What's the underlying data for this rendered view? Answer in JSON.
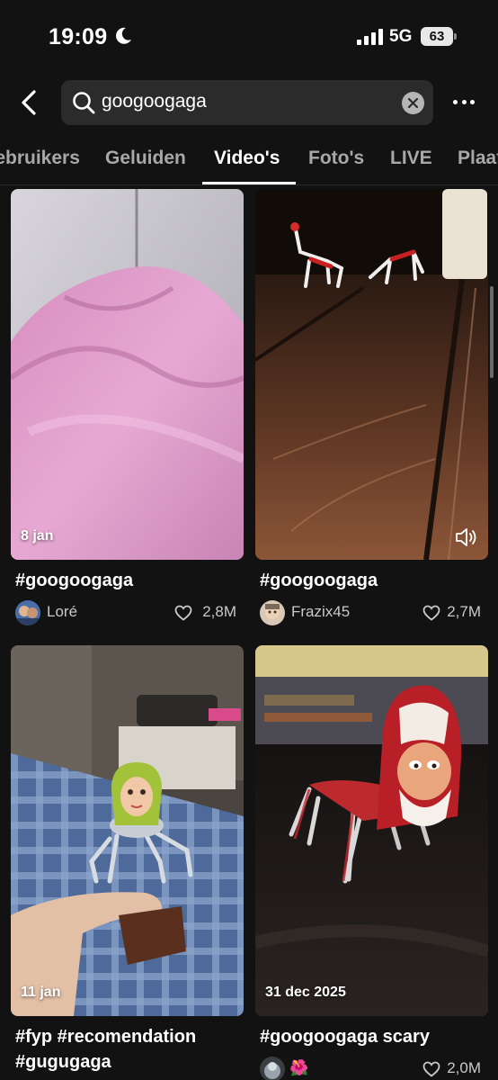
{
  "status_bar": {
    "time": "19:09",
    "network": "5G",
    "battery": "63"
  },
  "search": {
    "query": "googoogaga"
  },
  "tabs": [
    {
      "label": "Gebruikers"
    },
    {
      "label": "Geluiden"
    },
    {
      "label": "Video's"
    },
    {
      "label": "Foto's"
    },
    {
      "label": "LIVE"
    },
    {
      "label": "Plaatsen"
    }
  ],
  "active_tab": "Video's",
  "colors": {
    "background": "#121212",
    "search_bg": "#2b2b2b",
    "inactive_tab": "#a8a8a8"
  },
  "videos": [
    {
      "date": "8 jan",
      "caption": "#googoogaga",
      "user": "Loré",
      "likes": "2,8M"
    },
    {
      "date": "",
      "caption": "#googoogaga",
      "user": "Frazix45",
      "likes": "2,7M",
      "has_sound_icon": true
    },
    {
      "date": "11 jan",
      "caption": "#fyp #recomendation #gugugaga"
    },
    {
      "date": "31 dec 2025",
      "caption": "#googoogaga scary",
      "user": "🌺",
      "likes": "2,0M"
    }
  ]
}
